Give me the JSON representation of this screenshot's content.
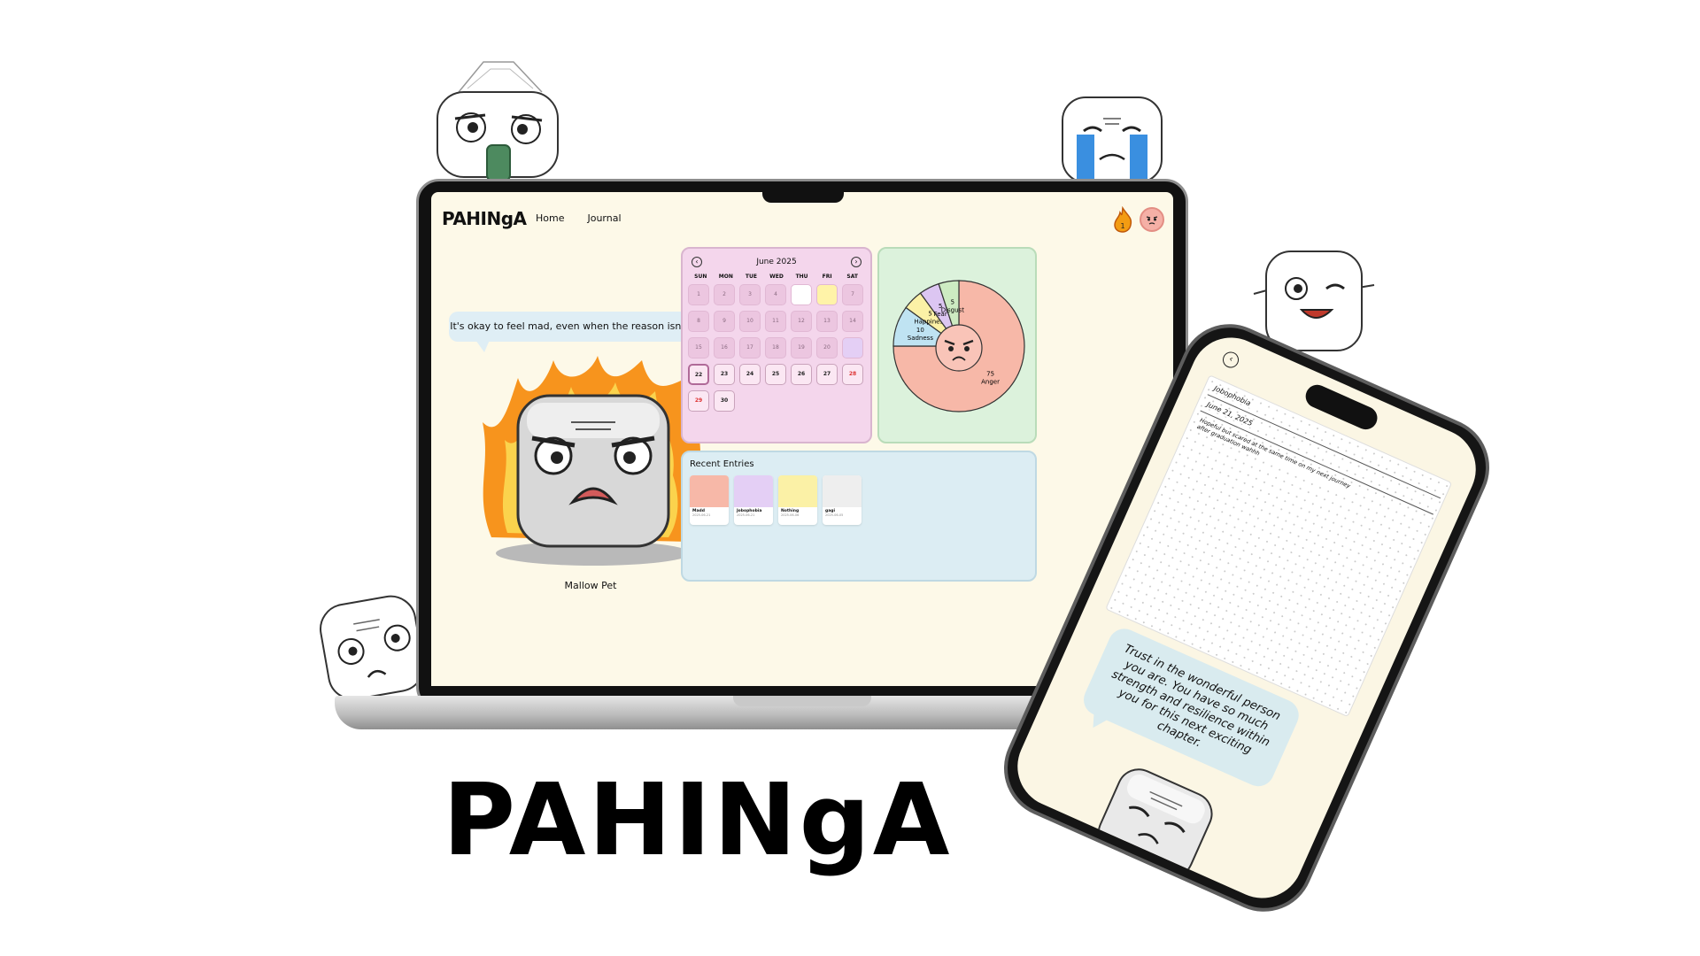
{
  "brand": "PAHINgA",
  "nav": {
    "home": "Home",
    "journal": "Journal"
  },
  "streak": {
    "count": "1"
  },
  "pet": {
    "message": "It's okay to feel mad, even when the reason isn't clear.",
    "label": "Mallow Pet"
  },
  "calendar": {
    "month": "June 2025",
    "weekdays": [
      "SUN",
      "MON",
      "TUE",
      "WED",
      "THU",
      "FRI",
      "SAT"
    ],
    "days": [
      "1",
      "2",
      "3",
      "4",
      "5",
      "6",
      "7",
      "8",
      "9",
      "10",
      "11",
      "12",
      "13",
      "14",
      "15",
      "16",
      "17",
      "18",
      "19",
      "20",
      "21",
      "22",
      "23",
      "24",
      "25",
      "26",
      "27",
      "28",
      "29",
      "30"
    ],
    "today": "22"
  },
  "chart_data": {
    "type": "pie",
    "slices": [
      {
        "label": "Anger",
        "value": 75,
        "color": "#f7b8a8"
      },
      {
        "label": "Sadness",
        "value": 10,
        "color": "#bfe3f2"
      },
      {
        "label": "Happiness",
        "value": 5,
        "color": "#fbf1a6"
      },
      {
        "label": "Fear",
        "value": 5,
        "color": "#dcc6f2"
      },
      {
        "label": "Disgust",
        "value": 5,
        "color": "#cdebc2"
      }
    ]
  },
  "recent": {
    "title": "Recent Entries",
    "entries": [
      {
        "name": "Madd",
        "date": "2025-06-21",
        "color": "#f7b8a8"
      },
      {
        "name": "Jobophobia",
        "date": "2025-06-21",
        "color": "#e4cff5"
      },
      {
        "name": "Nothing",
        "date": "2025-06-06",
        "color": "#fbf1a6"
      },
      {
        "name": "gagi",
        "date": "2025-06-05",
        "color": "#eeeeee"
      }
    ]
  },
  "title": "PAHINgA",
  "phone": {
    "entry_title": "Jobophobia",
    "entry_date": "June 21, 2025",
    "entry_body": "Hopeful but scared at the same time on my next journey after graduation wahhh",
    "message": "Trust in the wonderful person you are. You have so much strength and resilience within you for this next exciting chapter."
  },
  "colors": {
    "screen_bg": "#fdf9e8",
    "calendar_bg": "#f4d6ec",
    "pie_bg": "#dcf2dc",
    "recent_bg": "#dcedf3",
    "speech_bg": "#dfeef5"
  }
}
